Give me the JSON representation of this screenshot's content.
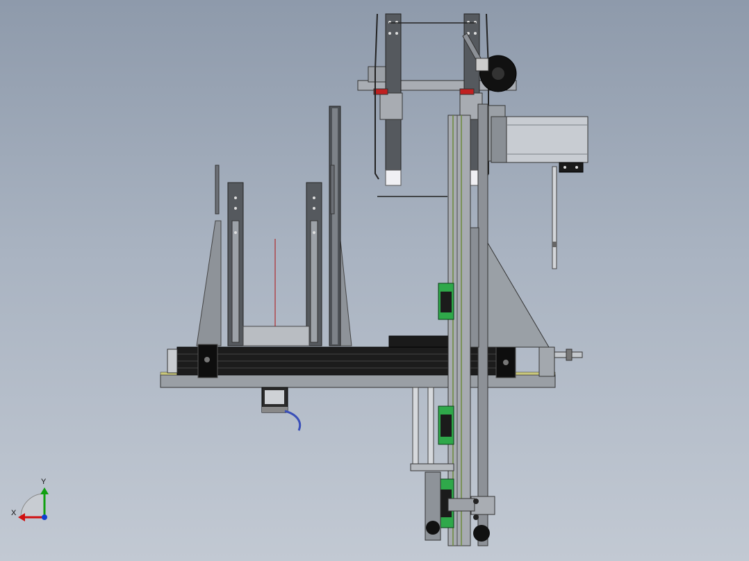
{
  "viewport": {
    "background_top": "#8e9aab",
    "background_bottom": "#c2c9d3"
  },
  "triad": {
    "x_label": "X",
    "y_label": "Y",
    "x_color": "#d01010",
    "y_color": "#10a010",
    "z_color": "#1040d0"
  },
  "colors": {
    "steel": "#8a8f96",
    "dark_steel": "#4d5054",
    "black_rail": "#1c1c1c",
    "green_block": "#2fa84a",
    "red_stop": "#c02020",
    "motor_body": "#c8ccd2",
    "cable": "#3a4fb8"
  }
}
